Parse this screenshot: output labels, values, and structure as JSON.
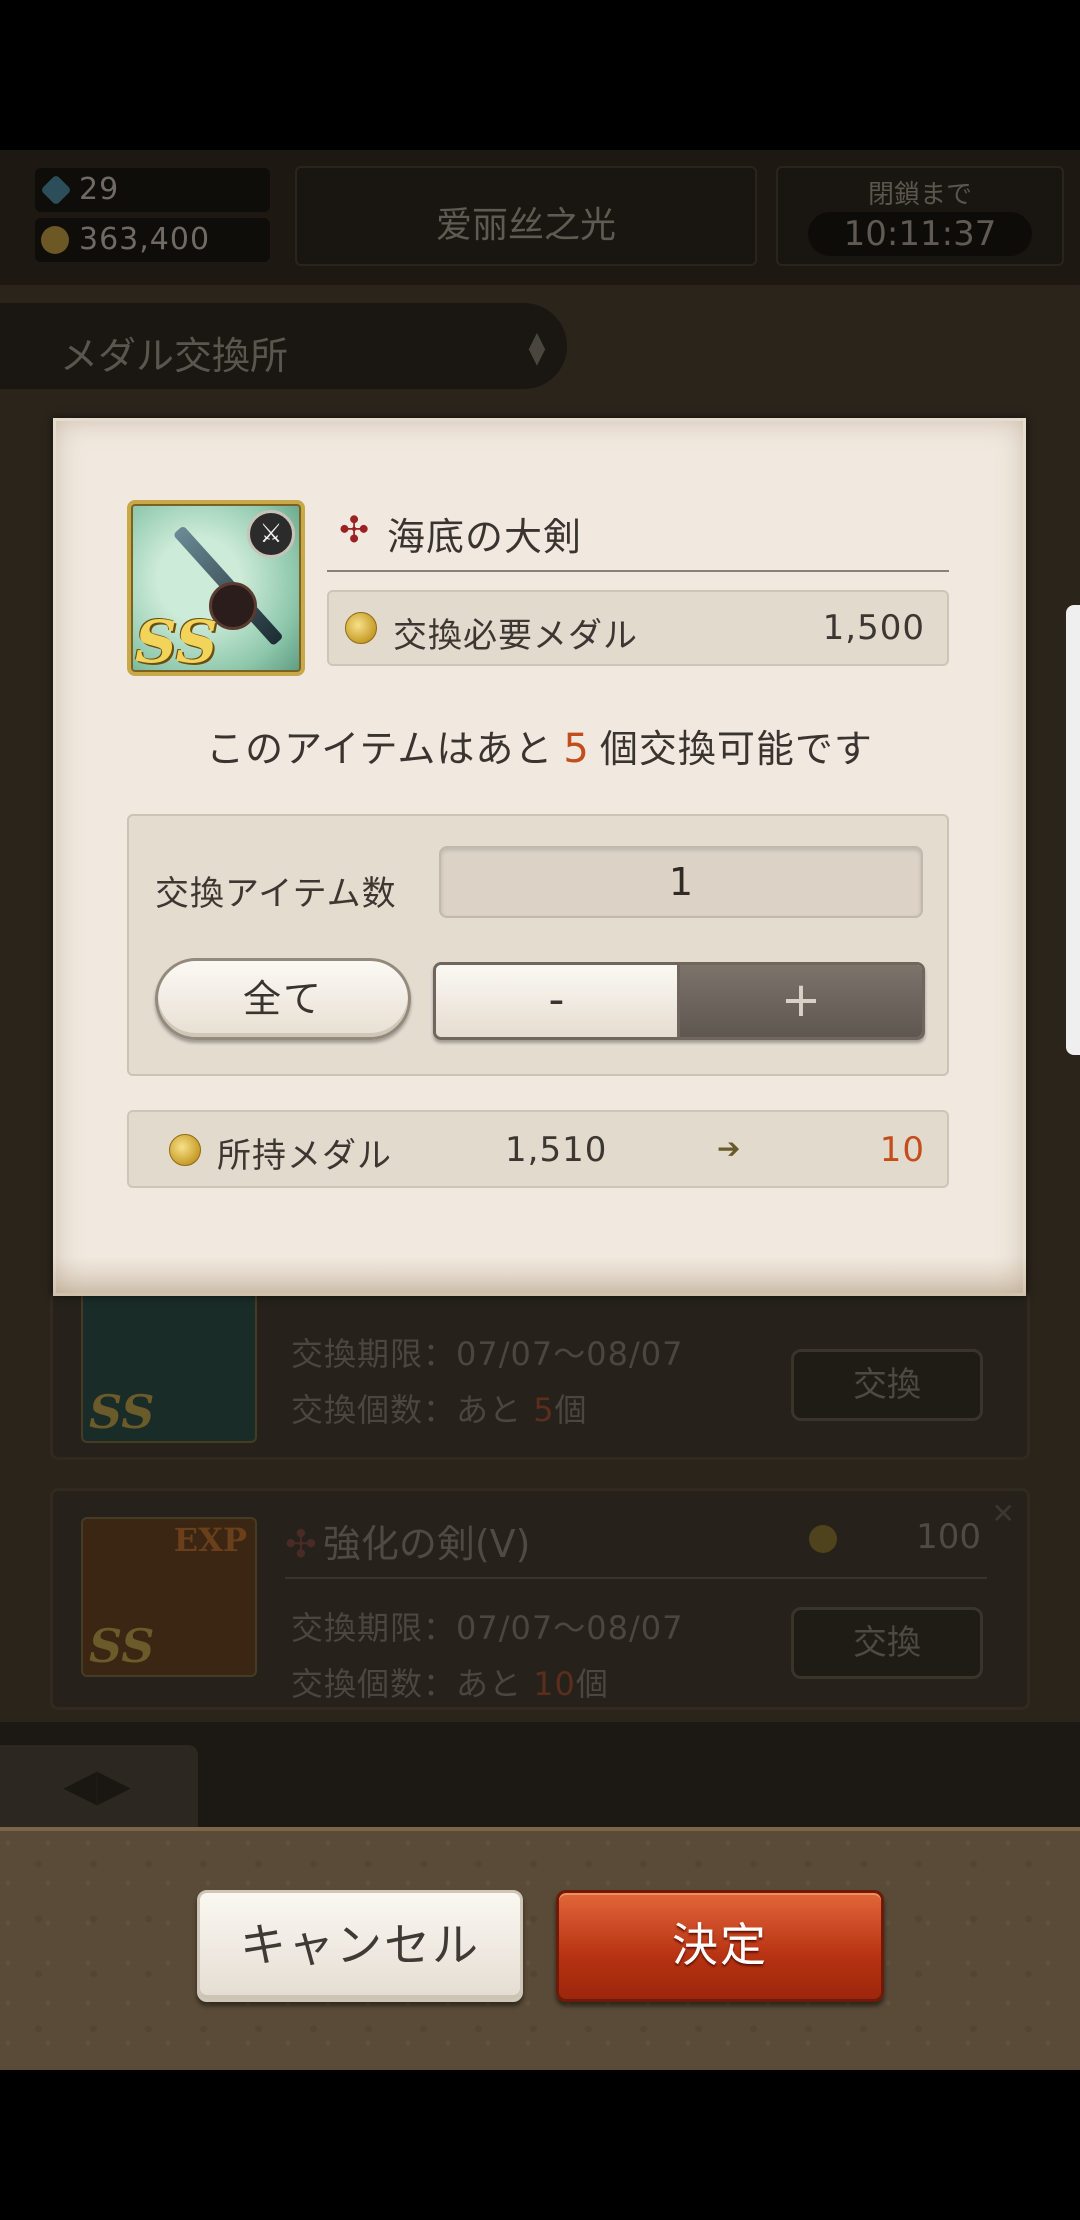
{
  "header": {
    "gems": "29",
    "coins": "363,400",
    "title": "爱丽丝之光",
    "timer_label": "閉鎖まで",
    "timer_value": "10:11:37"
  },
  "section": {
    "label": "メダル交換所"
  },
  "list": [
    {
      "name": "",
      "period": "交換期限：07/07～08/07",
      "count_prefix": "交換個数：あと",
      "count_num": "5",
      "count_suffix": "個",
      "button": "交換",
      "badge": "SS"
    },
    {
      "name": "強化の剣(V)",
      "cost": "100",
      "period": "交換期限：07/07～08/07",
      "count_prefix": "交換個数：あと",
      "count_num": "10",
      "count_suffix": "個",
      "button": "交換",
      "badge": "SS",
      "tag": "EXP"
    }
  ],
  "modal": {
    "item_name": "海底の大剣",
    "item_rarity": "SS",
    "item_icon": "weapon-sword-icon",
    "required_label": "交換必要メダル",
    "required_value": "1,500",
    "remaining_prefix": "このアイテムはあと",
    "remaining_count": "5",
    "remaining_suffix": "個交換可能です",
    "qty_label": "交換アイテム数",
    "qty_value": "1",
    "all_label": "全て",
    "minus_label": "-",
    "plus_label": "+",
    "own_label": "所持メダル",
    "own_value": "1,510",
    "own_after": "10"
  },
  "footer": {
    "cancel_label": "キャンセル",
    "ok_label": "決定"
  },
  "colors": {
    "accent_orange": "#c44e1b",
    "ok_button": "#b73212",
    "coin_gold": "#c89d2a"
  }
}
